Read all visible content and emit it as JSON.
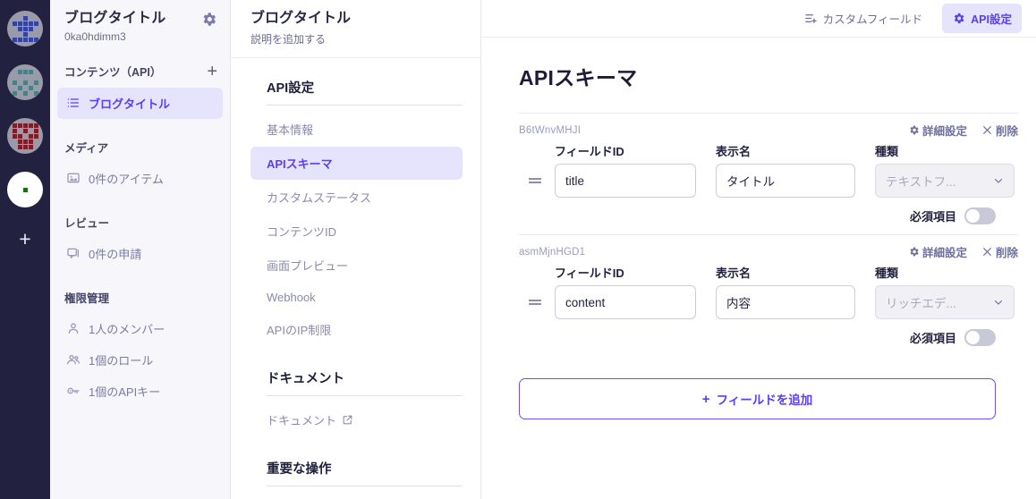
{
  "rail": {
    "avatars": [
      {
        "name": "workspace-avatar-1",
        "bg": "#9a9aa8",
        "fg": "#36459b",
        "pattern": [
          0,
          0,
          1,
          0,
          0,
          1,
          1,
          1,
          1,
          1,
          0,
          1,
          1,
          1,
          0,
          0,
          0,
          1,
          0,
          0,
          1,
          1,
          1,
          1,
          1
        ]
      },
      {
        "name": "workspace-avatar-2",
        "bg": "#9a9aa8",
        "fg": "#4a7f85",
        "pattern": [
          0,
          1,
          1,
          1,
          0,
          0,
          0,
          0,
          0,
          0,
          1,
          0,
          1,
          0,
          1,
          0,
          1,
          0,
          1,
          0,
          1,
          0,
          1,
          0,
          1
        ]
      },
      {
        "name": "workspace-avatar-3",
        "bg": "#9a9aa8",
        "fg": "#7a1f2b",
        "pattern": [
          1,
          1,
          1,
          1,
          1,
          1,
          0,
          1,
          0,
          1,
          1,
          1,
          0,
          1,
          1,
          0,
          1,
          1,
          1,
          0,
          0,
          1,
          1,
          1,
          0
        ]
      },
      {
        "name": "workspace-avatar-4",
        "bg": "#ffffff",
        "fg": "#1d6e12",
        "pattern": [
          0,
          0,
          0,
          0,
          0,
          0,
          0,
          0,
          0,
          0,
          0,
          0,
          1,
          0,
          0,
          0,
          0,
          0,
          0,
          0,
          0,
          0,
          0,
          0,
          0
        ]
      }
    ],
    "add_label": "+"
  },
  "sidebar": {
    "title": "ブログタイトル",
    "subtitle": "0ka0hdimm3",
    "gear_icon": "gear-icon",
    "sections": [
      {
        "title": "コンテンツ（API）",
        "has_add": true,
        "add_label": "+",
        "items": [
          {
            "label": "ブログタイトル",
            "icon": "list-icon",
            "active": true
          }
        ]
      },
      {
        "title": "メディア",
        "has_add": false,
        "items": [
          {
            "label": "0件のアイテム",
            "icon": "image-icon",
            "active": false
          }
        ]
      },
      {
        "title": "レビュー",
        "has_add": false,
        "items": [
          {
            "label": "0件の申請",
            "icon": "review-icon",
            "active": false
          }
        ]
      },
      {
        "title": "権限管理",
        "has_add": false,
        "items": [
          {
            "label": "1人のメンバー",
            "icon": "user-icon",
            "active": false
          },
          {
            "label": "1個のロール",
            "icon": "users-icon",
            "active": false
          },
          {
            "label": "1個のAPIキー",
            "icon": "key-icon",
            "active": false
          }
        ]
      }
    ]
  },
  "subnav": {
    "title": "ブログタイトル",
    "subtitle": "説明を追加する",
    "groups": [
      {
        "title": "API設定",
        "items": [
          {
            "label": "基本情報",
            "active": false,
            "external": false
          },
          {
            "label": "APIスキーマ",
            "active": true,
            "external": false
          },
          {
            "label": "カスタムステータス",
            "active": false,
            "external": false
          },
          {
            "label": "コンテンツID",
            "active": false,
            "external": false
          },
          {
            "label": "画面プレビュー",
            "active": false,
            "external": false
          },
          {
            "label": "Webhook",
            "active": false,
            "external": false
          },
          {
            "label": "APIのIP制限",
            "active": false,
            "external": false
          }
        ]
      },
      {
        "title": "ドキュメント",
        "items": [
          {
            "label": "ドキュメント",
            "active": false,
            "external": true
          }
        ]
      },
      {
        "title": "重要な操作",
        "items": []
      }
    ]
  },
  "topbar": {
    "custom_field_label": "カスタムフィールド",
    "custom_field_icon": "list-plus-icon",
    "api_settings_label": "API設定",
    "api_settings_icon": "gear-icon"
  },
  "main": {
    "page_title": "APIスキーマ",
    "column_headers": {
      "field_id": "フィールドID",
      "display_name": "表示名",
      "type": "種類"
    },
    "row_actions": {
      "detail_label": "詳細設定",
      "detail_icon": "gear-icon",
      "delete_label": "削除",
      "delete_icon": "close-icon"
    },
    "required_label": "必須項目",
    "add_field_label": "フィールドを追加",
    "add_field_plus": "+",
    "fields": [
      {
        "id": "B6tWnvMHJI",
        "field_id": "title",
        "display_name": "タイトル",
        "type": "テキストフ...",
        "required": false
      },
      {
        "id": "asmMjnHGD1",
        "field_id": "content",
        "display_name": "内容",
        "type": "リッチエデ...",
        "required": false
      }
    ]
  },
  "colors": {
    "accent": "#5b3df5",
    "accent_bg": "#e6e3fc",
    "rail_bg": "#222240",
    "sidebar_bg": "#f7f7fb",
    "muted_text": "#8a8aab"
  }
}
